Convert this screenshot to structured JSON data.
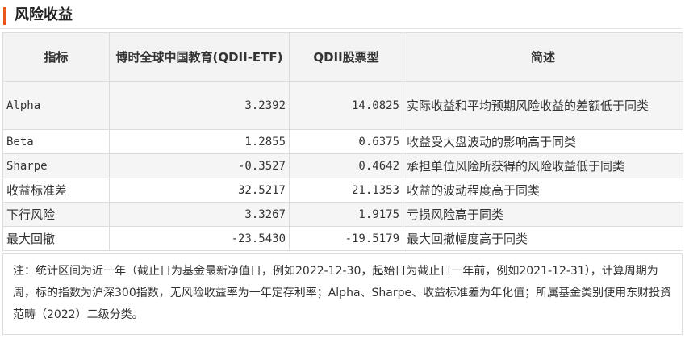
{
  "section": {
    "title": "风险收益",
    "accent_color": "#e85a1b"
  },
  "table": {
    "headers": [
      "指标",
      "博时全球中国教育(QDII-ETF)",
      "QDII股票型",
      "简述"
    ],
    "rows": [
      {
        "metric": "Alpha",
        "fund": "3.2392",
        "category": "14.0825",
        "desc": "实际收益和平均预期风险收益的差额低于同类"
      },
      {
        "metric": "Beta",
        "fund": "1.2855",
        "category": "0.6375",
        "desc": "收益受大盘波动的影响高于同类"
      },
      {
        "metric": "Sharpe",
        "fund": "-0.3527",
        "category": "0.4642",
        "desc": "承担单位风险所获得的风险收益低于同类"
      },
      {
        "metric": "收益标准差",
        "fund": "32.5217",
        "category": "21.1353",
        "desc": "收益的波动程度高于同类"
      },
      {
        "metric": "下行风险",
        "fund": "3.3267",
        "category": "1.9175",
        "desc": "亏损风险高于同类"
      },
      {
        "metric": "最大回撤",
        "fund": "-23.5430",
        "category": "-19.5179",
        "desc": "最大回撤幅度高于同类"
      }
    ]
  },
  "note": "注：统计区间为近一年（截止日为基金最新净值日，例如2022-12-30，起始日为截止日一年前，例如2021-12-31），计算周期为周，标的指数为沪深300指数，无风险收益率为一年定存利率；Alpha、Sharpe、收益标准差为年化值；所属基金类别使用东财投资范畴（2022）二级分类。"
}
